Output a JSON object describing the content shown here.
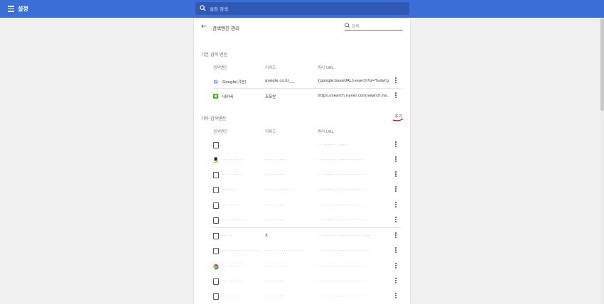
{
  "header": {
    "title": "설정",
    "search_placeholder": "설정 검색",
    "menu_icon": "hamburger-menu-icon",
    "search_icon": "search-icon",
    "accent": "#3b6fd7"
  },
  "page": {
    "title": "검색엔진 관리",
    "search_placeholder": "검색",
    "back_icon": "arrow-back-icon"
  },
  "default_engines": {
    "section_title": "기본 검색 엔진",
    "headers": {
      "name": "검색엔진",
      "keyword": "키워드",
      "url": "쿼리 URL"
    },
    "rows": [
      {
        "name": "Google(기본)",
        "keyword": "google.co.kr___",
        "url": "{google:baseURL}search?q=%s&{go...",
        "icon": "google-icon"
      },
      {
        "name": "네이버",
        "keyword": "조폭찬",
        "url": "https://search.naver.com/search.na...",
        "icon": "naver-icon"
      }
    ]
  },
  "other_engines": {
    "section_title": "기타 검색엔진",
    "add_label": "추가",
    "headers": {
      "name": "검색엔진",
      "keyword": "키워드",
      "url": "쿼리 URL"
    },
    "rows": [
      {
        "name": "",
        "keyword": "",
        "url": "··············",
        "icon": "page-icon"
      },
      {
        "name": "···········",
        "keyword": "··········",
        "url": "·······················",
        "icon": "amazon-icon"
      },
      {
        "name": "··········",
        "keyword": "··········",
        "url": "························",
        "icon": "page-icon"
      },
      {
        "name": "·······",
        "keyword": "··············",
        "url": "·······················",
        "icon": "page-icon"
      },
      {
        "name": "·········",
        "keyword": "·········",
        "url": "·······················",
        "icon": "page-icon"
      },
      {
        "name": "············",
        "keyword": "··········",
        "url": "························",
        "icon": "page-icon"
      },
      {
        "name": "·····",
        "keyword": "X",
        "url": "··························",
        "icon": "page-icon"
      },
      {
        "name": "··················",
        "keyword": "···················",
        "url": "························",
        "icon": "page-icon"
      },
      {
        "name": "···········",
        "keyword": "············",
        "url": "·······················",
        "icon": "chrome-icon"
      },
      {
        "name": "···········",
        "keyword": "·········",
        "url": "·······················",
        "icon": "page-icon"
      },
      {
        "name": "··········",
        "keyword": "·········",
        "url": "·······················",
        "icon": "page-icon"
      }
    ]
  }
}
